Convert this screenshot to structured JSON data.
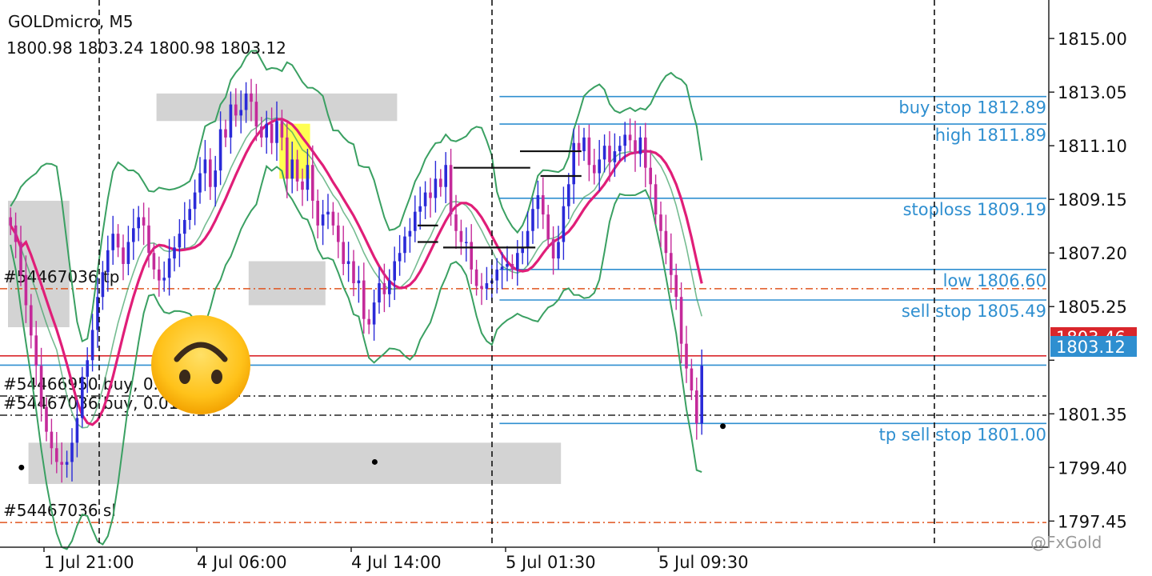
{
  "header": {
    "symbol": "GOLDmicro, M5",
    "ohlc": "1800.98 1803.24 1800.98 1803.12"
  },
  "chart_data": {
    "type": "candlestick",
    "symbol": "GOLDmicro",
    "timeframe": "M5",
    "ylim": [
      1796.5,
      1816.4
    ],
    "y_ticks": [
      1815.0,
      1813.05,
      1811.1,
      1809.15,
      1807.2,
      1805.25,
      1803.3,
      1801.35,
      1799.4,
      1797.45
    ],
    "y_tick_labels": [
      "1815.00",
      "1813.05",
      "1811.10",
      "1809.15",
      "1807.20",
      "1805.25",
      "",
      "1801.35",
      "1799.40",
      "1797.45"
    ],
    "x_tick_labels": [
      "1 Jul 21:00",
      "4 Jul 06:00",
      "4 Jul 14:00",
      "5 Jul 01:30",
      "5 Jul 09:30"
    ],
    "x_tick_bars": [
      13,
      30,
      50,
      70,
      90
    ],
    "bar_count": 136,
    "last_ohlc": {
      "open": 1800.98,
      "high": 1803.24,
      "low": 1800.98,
      "close": 1803.12
    },
    "bid_price": "1803.12",
    "ask_price": "1803.46",
    "closes": [
      1808.2,
      1807.6,
      1806.4,
      1805.3,
      1804.2,
      1803.1,
      1801.6,
      1800.7,
      1800.1,
      1799.6,
      1799.5,
      1799.6,
      1800.3,
      1801.2,
      1802.7,
      1803.3,
      1804.4,
      1805.6,
      1806.5,
      1807.3,
      1807.9,
      1807.4,
      1806.8,
      1807.6,
      1808.1,
      1808.5,
      1808.2,
      1807.2,
      1806.6,
      1806.2,
      1806.3,
      1807.0,
      1807.4,
      1807.9,
      1808.4,
      1808.8,
      1809.4,
      1810.1,
      1810.6,
      1809.6,
      1810.2,
      1811.7,
      1811.4,
      1812.6,
      1812.2,
      1812.4,
      1813.0,
      1812.7,
      1811.8,
      1811.4,
      1811.9,
      1811.2,
      1812.0,
      1811.4,
      1809.9,
      1810.6,
      1809.8,
      1809.5,
      1810.4,
      1809.1,
      1808.2,
      1808.6,
      1808.7,
      1808.2,
      1807.6,
      1806.8,
      1806.9,
      1806.1,
      1806.2,
      1804.8,
      1804.6,
      1805.4,
      1806.1,
      1805.7,
      1806.2,
      1806.9,
      1807.2,
      1807.8,
      1808.0,
      1808.7,
      1808.9,
      1809.4,
      1809.2,
      1809.9,
      1809.6,
      1810.4,
      1808.6,
      1808.0,
      1807.6,
      1807.6,
      1806.6,
      1806.0,
      1805.9,
      1806.1,
      1806.2,
      1806.6,
      1806.7,
      1806.8,
      1806.6,
      1807.2,
      1807.4,
      1808.0,
      1808.8,
      1809.3,
      1808.6,
      1807.7,
      1807.0,
      1807.6,
      1808.9,
      1809.7,
      1811.2,
      1810.9,
      1811.4,
      1810.4,
      1810.1,
      1810.6,
      1811.1,
      1810.5,
      1810.9,
      1811.1,
      1811.5,
      1811.3,
      1810.8,
      1811.4,
      1810.3,
      1809.7,
      1808.6,
      1808.0,
      1807.2,
      1806.4,
      1805.6,
      1803.9,
      1803.0,
      1802.2,
      1801.0,
      1803.1
    ],
    "buckets": [
      {
        "ylo": 1804.5,
        "yhi": 1809.1,
        "xlo_bar": 0,
        "xhi_bar": 12
      },
      {
        "ylo": 1812.0,
        "yhi": 1813.0,
        "xlo_bar": 29,
        "xhi_bar": 76
      },
      {
        "ylo": 1805.3,
        "yhi": 1806.9,
        "xlo_bar": 47,
        "xhi_bar": 62
      },
      {
        "ylo": 1798.8,
        "yhi": 1800.3,
        "xlo_bar": 4,
        "xhi_bar": 108
      }
    ],
    "levels": [
      {
        "name": "buy stop",
        "value": 1812.89,
        "label": "buy stop 1812.89",
        "color": "#2f8fd0"
      },
      {
        "name": "high",
        "value": 1811.89,
        "label": "high 1811.89",
        "color": "#2f8fd0"
      },
      {
        "name": "stoploss",
        "value": 1809.19,
        "label": "stoploss 1809.19",
        "color": "#2f8fd0"
      },
      {
        "name": "low",
        "value": 1806.6,
        "label": "low 1806.60",
        "color": "#2f8fd0"
      },
      {
        "name": "sell stop",
        "value": 1805.49,
        "label": "sell stop 1805.49",
        "color": "#2f8fd0"
      },
      {
        "name": "tp sell stop",
        "value": 1801.0,
        "label": "tp sell stop 1801.00",
        "color": "#2f8fd0"
      }
    ],
    "order_lines": [
      {
        "label": "#54467036 tp",
        "value": 1805.9
      },
      {
        "label": "#54466950 buy, 0.01",
        "value": 1802.0
      },
      {
        "label": "#54467036 buy, 0.01",
        "value": 1801.3
      },
      {
        "label": "#54467036 sl",
        "value": 1797.4
      }
    ],
    "ask_line": 1803.46,
    "bid_line": 1803.12
  },
  "watermark": "@FxGold",
  "colors": {
    "bull": "#2a2ad8",
    "bear": "#c42a9a",
    "ma": "#e01e78",
    "bands": "#3aa062",
    "level": "#2f8fd0",
    "ask": "#d9262b",
    "bid": "#2f8fd0",
    "order": "#e0541f",
    "zone": "#d3d3d3",
    "highlight": "#ffff33"
  }
}
